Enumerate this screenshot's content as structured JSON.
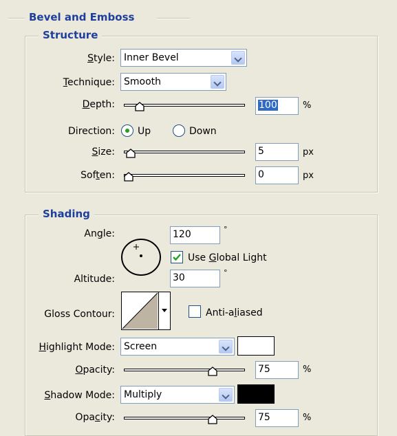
{
  "titles": {
    "bevel_and_emboss": "Bevel and Emboss",
    "structure": "Structure",
    "shading": "Shading"
  },
  "structure": {
    "style": {
      "label_pre": "",
      "label_key": "S",
      "label_post": "tyle:",
      "value": "Inner Bevel"
    },
    "technique": {
      "label_pre": "",
      "label_key": "T",
      "label_post": "echnique:",
      "value": "Smooth"
    },
    "depth": {
      "label_pre": "",
      "label_key": "D",
      "label_post": "epth:",
      "value": "100",
      "unit": "%",
      "slider_fraction": 0.1
    },
    "direction": {
      "label": "Direction:",
      "up": "Up",
      "down": "Down",
      "selected": "Up"
    },
    "size": {
      "label_pre": "",
      "label_key": "S",
      "label_post": "ize:",
      "value": "5",
      "unit": "px",
      "slider_fraction": 0.02
    },
    "soften": {
      "label_pre": "Sof",
      "label_key": "t",
      "label_post": "en:",
      "value": "0",
      "unit": "px",
      "slider_fraction": 0.0
    }
  },
  "shading": {
    "angle": {
      "label_pre": "An",
      "label_key": "g",
      "label_post": "le:",
      "value": "120",
      "unit": "°"
    },
    "use_global_light": {
      "label_pre": "Use ",
      "label_key": "G",
      "label_post": "lobal Light",
      "checked": true
    },
    "altitude": {
      "label": "Altitude:",
      "value": "30",
      "unit": "°"
    },
    "gloss_contour": {
      "label": "Gloss Contour:",
      "anti_aliased_pre": "Anti-a",
      "anti_aliased_key": "l",
      "anti_aliased_post": "iased",
      "anti_aliased_checked": false
    },
    "highlight_mode": {
      "label_pre": "",
      "label_key": "H",
      "label_post": "ighlight Mode:",
      "value": "Screen",
      "color": "#ffffff"
    },
    "highlight_opacity": {
      "label_pre": "",
      "label_key": "O",
      "label_post": "pacity:",
      "value": "75",
      "unit": "%",
      "slider_fraction": 0.75
    },
    "shadow_mode": {
      "label_pre": "",
      "label_key": "S",
      "label_post": "hadow Mode:",
      "value": "Multiply",
      "color": "#000000"
    },
    "shadow_opacity": {
      "label_pre": "Opa",
      "label_key": "c",
      "label_post": "ity:",
      "value": "75",
      "unit": "%",
      "slider_fraction": 0.75
    }
  },
  "icons": {
    "dropdown": "chevron-down-icon",
    "slider_thumb": "slider-thumb-icon",
    "angle_dial": "angle-dial-icon",
    "checkmark": "checkmark-icon",
    "contour_preview": "gloss-contour-icon"
  }
}
